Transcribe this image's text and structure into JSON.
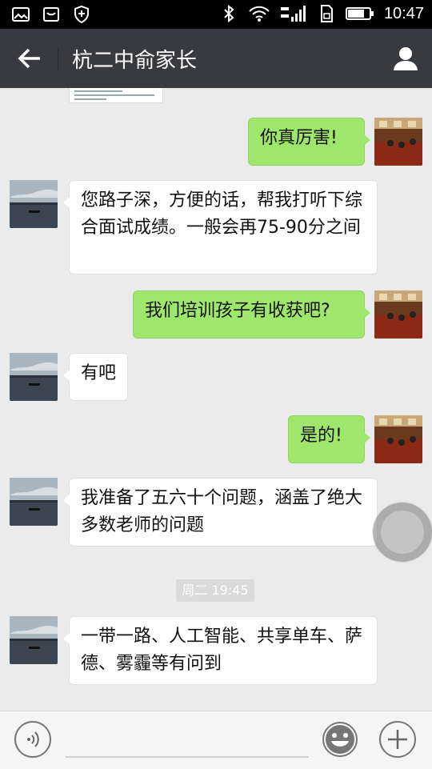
{
  "status_bar": {
    "time": "10:47",
    "icons": [
      "gallery-icon",
      "inbox-icon",
      "shield-icon",
      "bluetooth-icon",
      "wifi-icon",
      "signal-icon",
      "sim-icon",
      "battery-icon"
    ]
  },
  "header": {
    "title": "杭二中俞家长",
    "back_icon": "back-arrow-icon",
    "profile_icon": "person-icon"
  },
  "messages": [
    {
      "side": "out",
      "text": "你真厉害!"
    },
    {
      "side": "in",
      "text": "您路子深，方便的话，帮我打听下综合面试成绩。一般会再75-90分之间"
    },
    {
      "side": "out",
      "text": "我们培训孩子有收获吧?"
    },
    {
      "side": "in",
      "text": "有吧"
    },
    {
      "side": "out",
      "text": "是的!"
    },
    {
      "side": "in",
      "text": "我准备了五六十个问题，涵盖了绝大多数老师的问题"
    },
    {
      "side": "in",
      "text": "一带一路、人工智能、共享单车、萨德、雾霾等有问到"
    }
  ],
  "timestamp": "周二 19:45",
  "input_bar": {
    "voice_icon": "voice-icon",
    "emoji_icon": "emoji-icon",
    "plus_icon": "plus-icon"
  },
  "colors": {
    "header_bg": "#393a3f",
    "chat_bg": "#ebebeb",
    "out_bubble": "#9ee66c",
    "in_bubble": "#ffffff"
  }
}
